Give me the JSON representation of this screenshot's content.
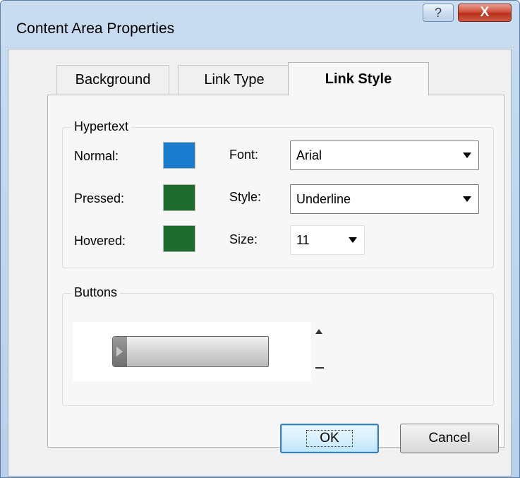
{
  "window": {
    "title": "Content Area Properties",
    "help_glyph": "?",
    "close_glyph": "X"
  },
  "tabs": [
    {
      "label": "Background",
      "selected": false
    },
    {
      "label": "Link Type",
      "selected": false
    },
    {
      "label": "Link Style",
      "selected": true
    }
  ],
  "hypertext": {
    "group_label": "Hypertext",
    "normal_label": "Normal:",
    "normal_color": "#1b7cce",
    "pressed_label": "Pressed:",
    "pressed_color": "#1d6b2f",
    "hovered_label": "Hovered:",
    "hovered_color": "#1d6b2f",
    "font_label": "Font:",
    "font_value": "Arial",
    "style_label": "Style:",
    "style_value": "Underline",
    "size_label": "Size:",
    "size_value": "11"
  },
  "buttons_group": {
    "group_label": "Buttons"
  },
  "dialog_buttons": {
    "ok_label": "OK",
    "cancel_label": "Cancel"
  }
}
